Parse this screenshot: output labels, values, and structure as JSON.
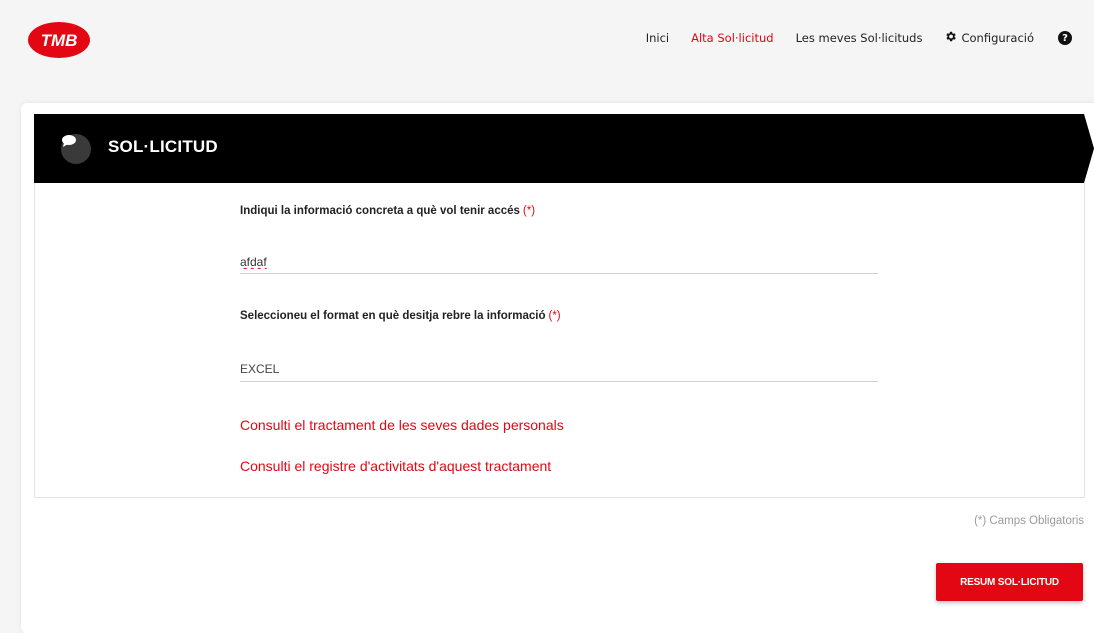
{
  "brand": {
    "logo_text": "TMB",
    "accent_color": "#e30613"
  },
  "nav": {
    "items": [
      {
        "label": "Inici",
        "active": false
      },
      {
        "label": "Alta Sol·licitud",
        "active": true
      },
      {
        "label": "Les meves Sol·licituds",
        "active": false
      },
      {
        "label": "Configuració",
        "active": false,
        "icon": "gear-icon"
      }
    ],
    "help_icon": "?"
  },
  "banner": {
    "title": "SOL·LICITUD",
    "icon": "chat-bubble-icon"
  },
  "form": {
    "info_label": "Indiqui la informació concreta a què vol tenir accés",
    "info_required": "(*)",
    "info_value": "afdaf",
    "format_label": "Seleccioneu el format en què desitja rebre la informació",
    "format_required": "(*)",
    "format_value": "EXCEL",
    "link_personal_data": "Consulti el tractament de les seves dades personals",
    "link_activity_registry": "Consulti el registre d'activitats d'aquest tractament"
  },
  "footer": {
    "required_note": "(*) Camps Obligatoris",
    "summary_button": "RESUM SOL·LICITUD"
  }
}
